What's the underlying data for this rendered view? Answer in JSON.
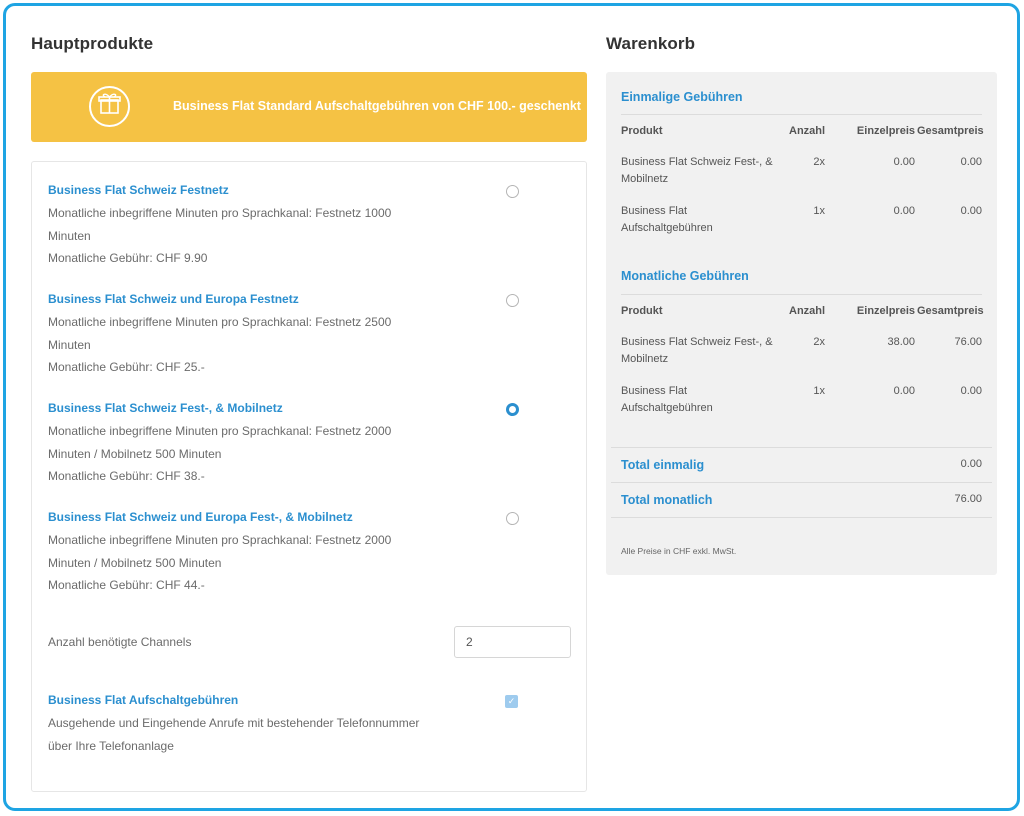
{
  "left_title": "Hauptprodukte",
  "right_title": "Warenkorb",
  "banner": {
    "icon": "gift-icon",
    "text": "Business Flat Standard Aufschaltgebühren von CHF 100.- geschenkt",
    "color": "#f5c244"
  },
  "products": [
    {
      "name": "Business Flat Schweiz Festnetz",
      "lines": [
        "Monatliche inbegriffene Minuten pro Sprachkanal: Festnetz 1000",
        "Minuten",
        "Monatliche Gebühr: CHF 9.90"
      ],
      "selected": false
    },
    {
      "name": "Business Flat Schweiz und Europa Festnetz",
      "lines": [
        "Monatliche inbegriffene Minuten pro Sprachkanal: Festnetz 2500",
        "Minuten",
        "Monatliche Gebühr: CHF 25.-"
      ],
      "selected": false
    },
    {
      "name": "Business Flat Schweiz Fest-, & Mobilnetz",
      "lines": [
        "Monatliche inbegriffene Minuten pro Sprachkanal: Festnetz 2000",
        "Minuten / Mobilnetz 500 Minuten",
        "Monatliche Gebühr: CHF 38.-"
      ],
      "selected": true
    },
    {
      "name": "Business Flat Schweiz und Europa Fest-, & Mobilnetz",
      "lines": [
        "Monatliche inbegriffene Minuten pro Sprachkanal: Festnetz 2000",
        "Minuten / Mobilnetz 500 Minuten",
        "Monatliche Gebühr: CHF 44.-"
      ],
      "selected": false
    }
  ],
  "channels": {
    "label": "Anzahl benötigte Channels",
    "value": "2"
  },
  "addon": {
    "name": "Business Flat Aufschaltgebühren",
    "lines": [
      "Ausgehende und Eingehende Anrufe mit bestehender Telefonnummer",
      "über Ihre Telefonanlage"
    ],
    "checked": true
  },
  "cart": {
    "columns": [
      "Produkt",
      "Anzahl",
      "Einzelpreis",
      "Gesamtpreis"
    ],
    "one_time": {
      "heading": "Einmalige Gebühren",
      "rows": [
        {
          "product": "Business Flat Schweiz Fest-, & Mobilnetz",
          "qty": "2x",
          "unit": "0.00",
          "total": "0.00"
        },
        {
          "product": "Business Flat Aufschaltgebühren",
          "qty": "1x",
          "unit": "0.00",
          "total": "0.00"
        }
      ]
    },
    "monthly": {
      "heading": "Monatliche Gebühren",
      "rows": [
        {
          "product": "Business Flat Schweiz Fest-, & Mobilnetz",
          "qty": "2x",
          "unit": "38.00",
          "total": "76.00"
        },
        {
          "product": "Business Flat Aufschaltgebühren",
          "qty": "1x",
          "unit": "0.00",
          "total": "0.00"
        }
      ]
    },
    "total_one_time": {
      "label": "Total einmalig",
      "value": "0.00"
    },
    "total_monthly": {
      "label": "Total monatlich",
      "value": "76.00"
    },
    "footnote": "Alle Preise in CHF exkl. MwSt."
  },
  "colors": {
    "accent": "#2b8fcf",
    "border": "#1ea4e3",
    "cart_bg": "#f1f1f1"
  }
}
